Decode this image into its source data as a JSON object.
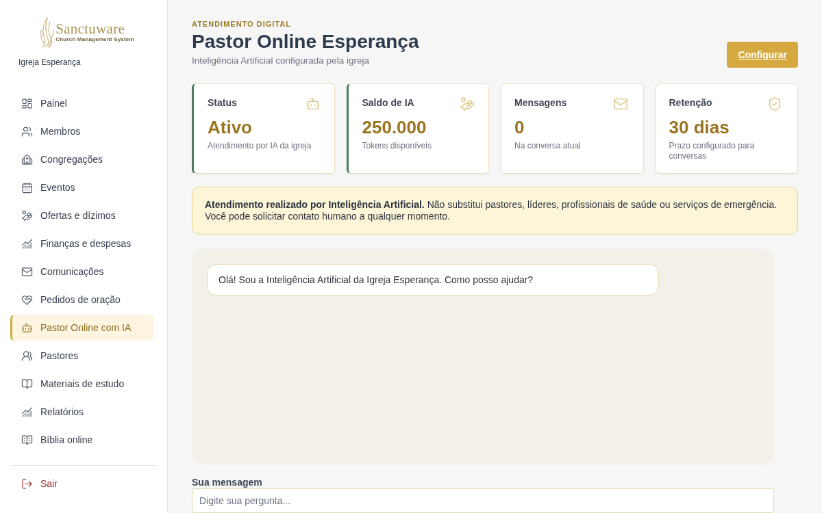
{
  "sidebar": {
    "logo": {
      "name": "Sanctuware",
      "tagline": "Church Management System"
    },
    "church_name": "Igreja Esperança",
    "nav_items": [
      {
        "label": "Painel",
        "selected": false
      },
      {
        "label": "Membros",
        "selected": false
      },
      {
        "label": "Congregações",
        "selected": false
      },
      {
        "label": "Eventos",
        "selected": false
      },
      {
        "label": "Ofertas e dízimos",
        "selected": false
      },
      {
        "label": "Finanças e despesas",
        "selected": false
      },
      {
        "label": "Comunicações",
        "selected": false
      },
      {
        "label": "Pedidos de oração",
        "selected": false
      },
      {
        "label": "Pastor Online com IA",
        "selected": true
      },
      {
        "label": "Pastores",
        "selected": false
      },
      {
        "label": "Materiais de estudo",
        "selected": false
      },
      {
        "label": "Relatórios",
        "selected": false
      },
      {
        "label": "Bíblia online",
        "selected": false
      }
    ],
    "logout": {
      "label": "Sair"
    }
  },
  "header": {
    "eyebrow": "ATENDIMENTO DIGITAL",
    "title": "Pastor Online Esperança",
    "subtitle": "Inteligência Artificial configurada pela igreja",
    "button": "Configurar"
  },
  "stat_cards": [
    {
      "title": "Status",
      "value": "Ativo",
      "caption": "Atendimento por IA da igreja",
      "accent": true
    },
    {
      "title": "Saldo de IA",
      "value": "250.000",
      "caption": "Tokens disponíveis",
      "accent": true
    },
    {
      "title": "Mensagens",
      "value": "0",
      "caption": "Na conversa atual",
      "accent": false
    },
    {
      "title": "Retenção",
      "value": "30 dias",
      "caption": "Prazo configurado para conversas",
      "accent": false
    }
  ],
  "notice": {
    "text": "**Atendimento realizado por Inteligência Artificial.** Não substitui pastores, líderes, profissionais de saúde ou serviços de emergência. Você pode solicitar contato humano a qualquer momento."
  },
  "chat": {
    "messages": [
      {
        "kind": "bot",
        "text": "Olá! Sou a Inteligência Artificial da Igreja Esperança. Como posso ajudar?"
      }
    ]
  },
  "composer": {
    "label": "Sua mensagem",
    "placeholder": "Digite sua pergunta..."
  }
}
